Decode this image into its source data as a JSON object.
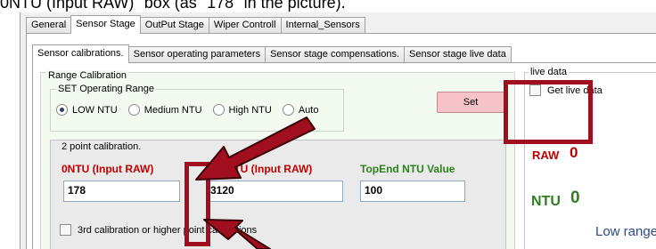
{
  "caption": "0NTU (Input RAW)\" box (as \"178\" in the picture).",
  "colors": {
    "annotation": "#a10e20",
    "accent_red": "#c00000",
    "accent_green": "#2f7f1f",
    "set_button": "#f7c3c8"
  },
  "main_tabs": [
    "General",
    "Sensor Stage",
    "OutPut Stage",
    "Wiper Controll",
    "Internal_Sensors"
  ],
  "main_tab_active": "Sensor Stage",
  "sub_tabs": [
    "Sensor calibrations.",
    "Sensor operating parameters",
    "Sensor stage compensations.",
    "Sensor stage live data"
  ],
  "sub_tab_active": "Sensor calibrations.",
  "range_calibration": {
    "legend": "Range Calibration",
    "operating_range": {
      "legend": "SET Operating Range",
      "options": [
        "LOW NTU",
        "Medium NTU",
        "High NTU",
        "Auto"
      ],
      "selected": "LOW NTU"
    },
    "set_button": "Set",
    "two_point": {
      "legend": "2 point calibration.",
      "zero_label": "0NTU (Input RAW)",
      "zero_value": "178",
      "top_label": "d NTU (Input RAW)",
      "top_value": "3120",
      "topend_label": "TopEnd NTU Value",
      "topend_value": "100"
    },
    "third_point_checkbox": "3rd calibration or higher point calibrations"
  },
  "live_data": {
    "legend": "live data",
    "get_checkbox": "Get live data",
    "raw_label": "RAW",
    "raw_value": "0",
    "ntu_label": "NTU",
    "ntu_value": "0",
    "range_text": "Low range"
  }
}
